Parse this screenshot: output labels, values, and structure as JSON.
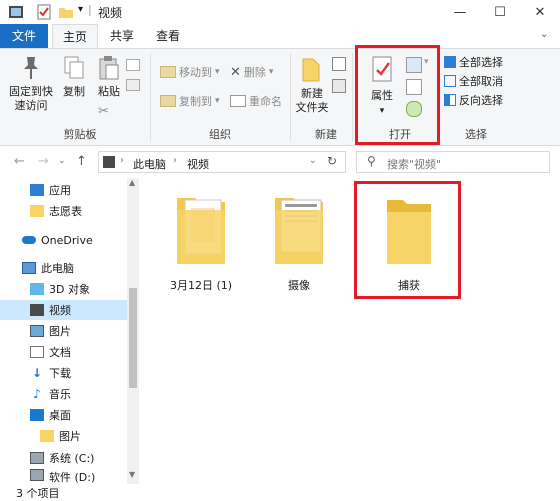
{
  "window": {
    "title": "视频",
    "minimize": "—",
    "maximize": "☐",
    "close": "✕"
  },
  "tabs": {
    "file": "文件",
    "home": "主页",
    "share": "共享",
    "view": "查看"
  },
  "ribbon": {
    "pin_quick_access": "固定到快\n速访问",
    "copy": "复制",
    "paste": "粘贴",
    "clipboard_group": "剪贴板",
    "move_to": "移动到",
    "copy_to": "复制到",
    "delete": "删除",
    "rename": "重命名",
    "organize_group": "组织",
    "new_folder": "新建\n文件夹",
    "new_group": "新建",
    "properties": "属性",
    "open_group": "打开",
    "select_all": "全部选择",
    "select_none": "全部取消",
    "invert_selection": "反向选择",
    "select_group": "选择"
  },
  "address": {
    "this_pc": "此电脑",
    "current": "视频",
    "search_placeholder": "搜索\"视频\""
  },
  "nav": {
    "items": [
      {
        "label": "应用",
        "icon": "apps-icon"
      },
      {
        "label": "志愿表",
        "icon": "folder-icon"
      },
      {
        "label": "OneDrive",
        "icon": "cloud-icon"
      },
      {
        "label": "此电脑",
        "icon": "computer-icon"
      },
      {
        "label": "3D 对象",
        "icon": "3d-icon"
      },
      {
        "label": "视频",
        "icon": "video-icon"
      },
      {
        "label": "图片",
        "icon": "pictures-icon"
      },
      {
        "label": "文档",
        "icon": "documents-icon"
      },
      {
        "label": "下载",
        "icon": "download-icon"
      },
      {
        "label": "音乐",
        "icon": "music-icon"
      },
      {
        "label": "桌面",
        "icon": "desktop-icon"
      },
      {
        "label": "图片",
        "icon": "folder-icon"
      },
      {
        "label": "系统 (C:)",
        "icon": "drive-icon"
      },
      {
        "label": "软件 (D:)",
        "icon": "drive-icon"
      }
    ]
  },
  "content": {
    "items": [
      {
        "label": "3月12日 (1)"
      },
      {
        "label": "摄像"
      },
      {
        "label": "捕获"
      }
    ]
  },
  "status": {
    "count": "3 个项目"
  },
  "colors": {
    "accent": "#1a6fc4",
    "highlight": "#e21b25",
    "selected": "#cce8ff",
    "folder": "#f7d468"
  }
}
